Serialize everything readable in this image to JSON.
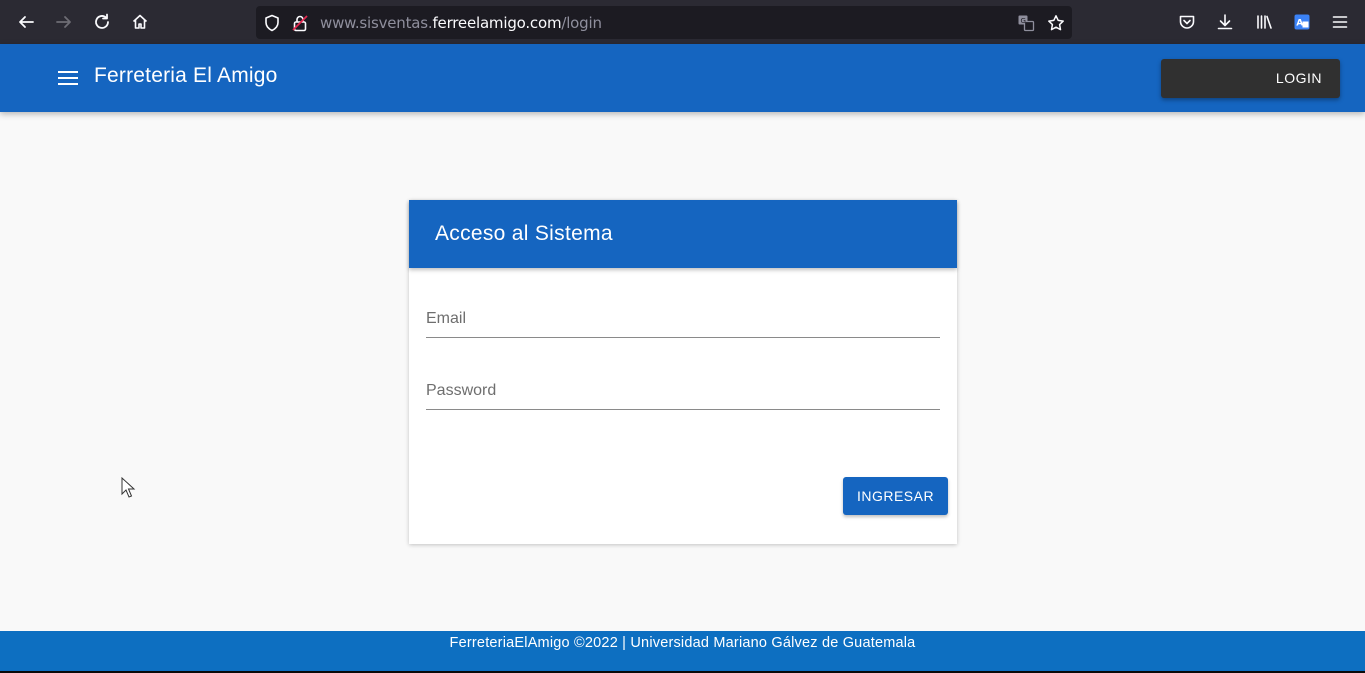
{
  "browser": {
    "url_prefix": "www.sisventas.",
    "url_domain": "ferreelamigo.com",
    "url_path": "/login",
    "icons": [
      "back-icon",
      "forward-icon",
      "reload-icon",
      "home-icon",
      "shield-icon",
      "lock-warning-icon",
      "translate-icon",
      "bookmark-star-icon",
      "pocket-icon",
      "download-icon",
      "library-icon",
      "translate-extension-icon",
      "hamburger-menu-icon"
    ]
  },
  "appbar": {
    "title": "Ferreteria El Amigo",
    "login_label": "LOGIN",
    "color": "#1565c0"
  },
  "card": {
    "title": "Acceso al Sistema",
    "email": {
      "placeholder": "Email",
      "value": ""
    },
    "password": {
      "placeholder": "Password",
      "value": ""
    },
    "submit_label": "INGRESAR"
  },
  "footer": {
    "text": "FerreteriaElAmigo ©2022 | Universidad Mariano Gálvez de Guatemala",
    "color": "#0d6fc1"
  }
}
